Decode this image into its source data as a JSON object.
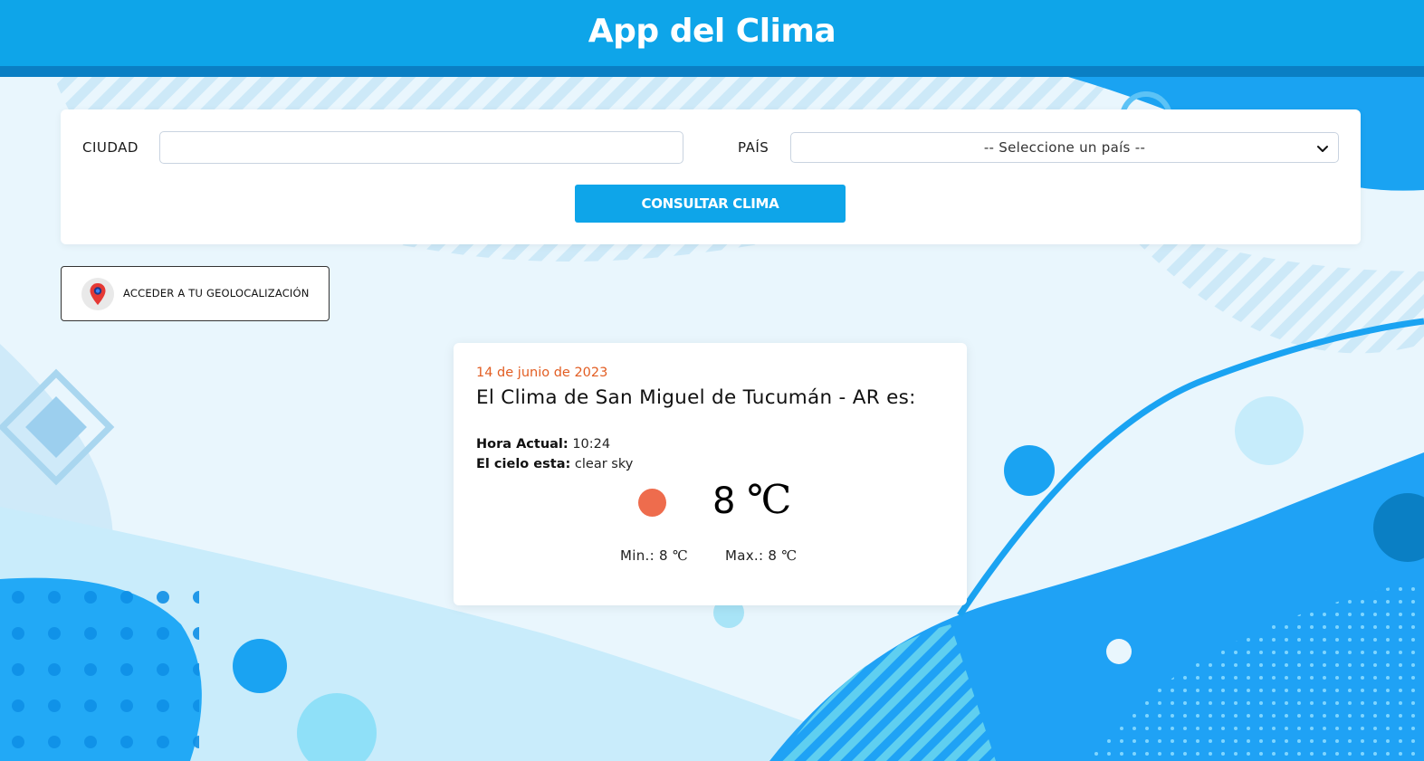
{
  "header": {
    "title": "App del Clima"
  },
  "search": {
    "city_label": "CIUDAD",
    "city_value": "",
    "country_label": "PAÍS",
    "country_selected": "-- Seleccione un país --",
    "submit_label": "CONSULTAR CLIMA"
  },
  "geo": {
    "label": "ACCEDER A TU GEOLOCALIZACIÓN",
    "icon": "map-pin-icon"
  },
  "weather": {
    "date": "14 de junio de 2023",
    "title": "El Clima de San Miguel de Tucumán - AR es:",
    "time_label": "Hora Actual:",
    "time_value": "10:24",
    "sky_label": "El cielo esta:",
    "sky_value": "clear sky",
    "temp_value": "8",
    "temp_unit": "℃",
    "min_label": "Min.: 8",
    "min_unit": "℃",
    "max_label": "Max.: 8",
    "max_unit": "℃",
    "icon": "sun-icon"
  },
  "colors": {
    "header": "#0ea5e9",
    "header_border": "#0a7fc4",
    "button": "#0ea5e9",
    "date": "#e25d22",
    "sun": "#ee6c4d",
    "background": "#e6f5fd"
  }
}
